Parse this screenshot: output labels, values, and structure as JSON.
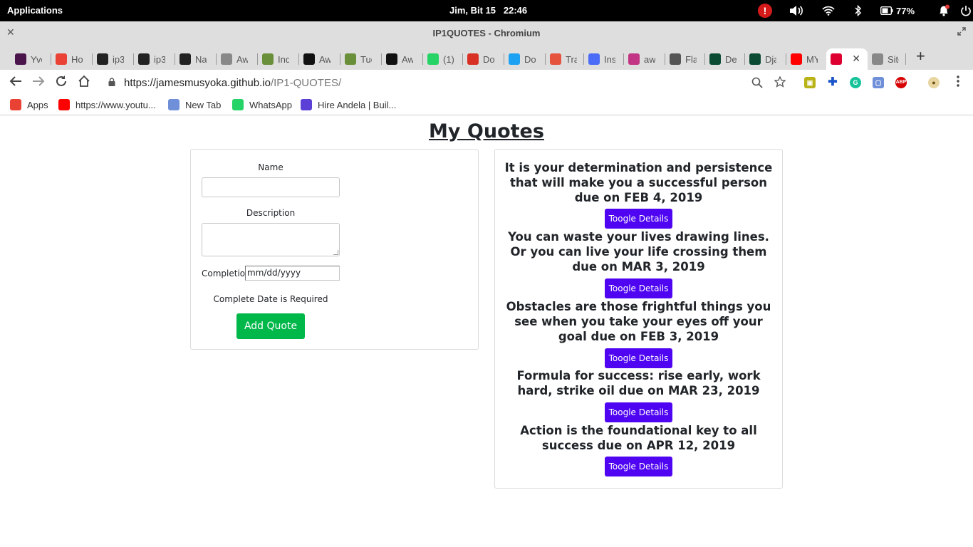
{
  "system_bar": {
    "applications_label": "Applications",
    "clock": "Jim, Bit 15   22:46",
    "battery_percent": "77%",
    "alert_mark": "!"
  },
  "window": {
    "title": "IP1QUOTES - Chromium",
    "close_glyph": "✕"
  },
  "tabs": [
    {
      "label": "Yvo",
      "icon": "slack-icon",
      "color": "#4a154b"
    },
    {
      "label": "Hot",
      "icon": "google-photos-icon",
      "color": "#ea4335"
    },
    {
      "label": "ip3",
      "icon": "github-icon",
      "color": "#222"
    },
    {
      "label": "ip3",
      "icon": "github-icon",
      "color": "#222"
    },
    {
      "label": "Nar",
      "icon": "github-icon",
      "color": "#222"
    },
    {
      "label": "Aw",
      "icon": "page-icon",
      "color": "#888"
    },
    {
      "label": "Ind",
      "icon": "tree-icon",
      "color": "#6a8f3a"
    },
    {
      "label": "Aw",
      "icon": "w-icon",
      "color": "#111"
    },
    {
      "label": "Tue",
      "icon": "tree-icon",
      "color": "#6a8f3a"
    },
    {
      "label": "Aw",
      "icon": "w-icon",
      "color": "#111"
    },
    {
      "label": "(1)",
      "icon": "whatsapp-icon",
      "color": "#25d366"
    },
    {
      "label": "Do",
      "icon": "gmail-icon",
      "color": "#d93025"
    },
    {
      "label": "Do",
      "icon": "twitter-icon",
      "color": "#1da1f2"
    },
    {
      "label": "Tra",
      "icon": "codepen-icon",
      "color": "#e5533d"
    },
    {
      "label": "Ins",
      "icon": "docs-icon",
      "color": "#4a6cf7"
    },
    {
      "label": "aw",
      "icon": "instagram-icon",
      "color": "#c13584"
    },
    {
      "label": "Fla",
      "icon": "flask-icon",
      "color": "#555"
    },
    {
      "label": "De",
      "icon": "django-icon",
      "color": "#0c4b33"
    },
    {
      "label": "Dja",
      "icon": "chart-icon",
      "color": "#0c4b33"
    },
    {
      "label": "MY",
      "icon": "youtube-icon",
      "color": "#ff0000"
    },
    {
      "label": "",
      "icon": "angular-icon",
      "color": "#dd0031",
      "active": true
    },
    {
      "label": "Site",
      "icon": "page-icon",
      "color": "#888"
    }
  ],
  "toolbar": {
    "url_host": "https://jamesmusyoka.github.io",
    "url_path": "/IP1-QUOTES/"
  },
  "bookmarks": [
    {
      "label": "Apps",
      "icon": "apps-grid-icon",
      "color": "#e94235"
    },
    {
      "label": "https://www.youtu...",
      "icon": "youtube-icon",
      "color": "#ff0000"
    },
    {
      "label": "New Tab",
      "icon": "new-tab-icon",
      "color": "#6f8fd8"
    },
    {
      "label": "WhatsApp",
      "icon": "whatsapp-icon",
      "color": "#25d366"
    },
    {
      "label": "Hire Andela | Buil...",
      "icon": "andela-icon",
      "color": "#5b3fd6"
    }
  ],
  "page": {
    "title": "My Quotes",
    "form": {
      "name_label": "Name",
      "description_label": "Description",
      "completion_label": "Completion",
      "date_placeholder": "mm/dd/yyyy",
      "date_error": "Complete Date is Required",
      "submit_label": "Add Quote"
    },
    "quotes": [
      {
        "text": "It is your determination and persistence that will make you a successful person due on FEB 4, 2019",
        "button": "Toogle Details"
      },
      {
        "text": "You can waste your lives drawing lines. Or you can live your life crossing them due on MAR 3, 2019",
        "button": "Toogle Details"
      },
      {
        "text": "Obstacles are those frightful things you see when you take your eyes off your goal due on FEB 3, 2019",
        "button": "Toogle Details"
      },
      {
        "text": "Formula for success: rise early, work hard, strike oil due on MAR 23, 2019",
        "button": "Toogle Details"
      },
      {
        "text": "Action is the foundational key to all success due on APR 12, 2019",
        "button": "Toogle Details"
      }
    ],
    "accent_colors": {
      "add_button": "#00b74a",
      "toggle_button": "#4f05f1"
    }
  }
}
